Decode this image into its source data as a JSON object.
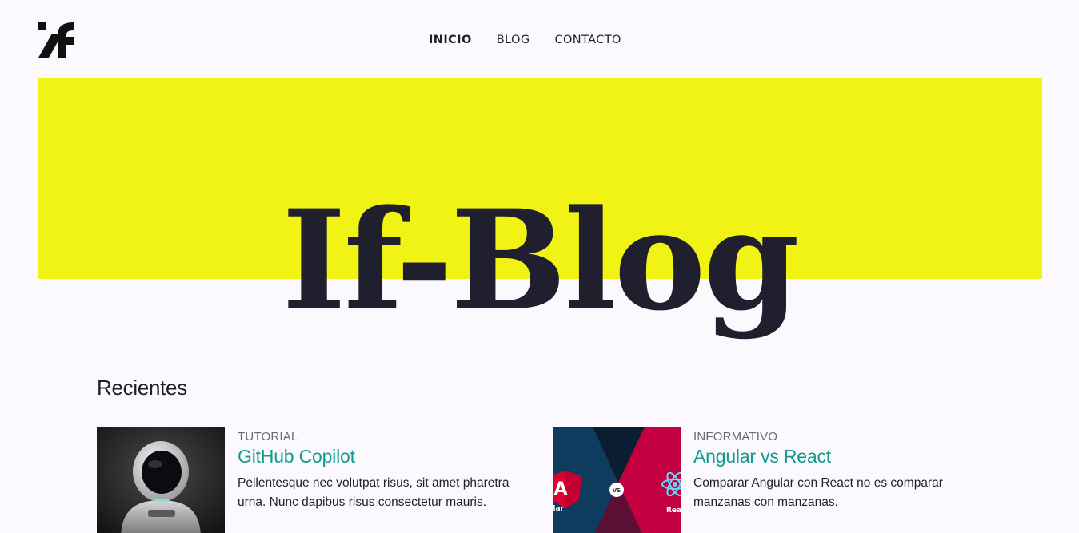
{
  "header": {
    "logo_icon": "if-logo-icon",
    "nav": [
      {
        "label": "INICIO",
        "active": true
      },
      {
        "label": "BLOG",
        "active": false
      },
      {
        "label": "CONTACTO",
        "active": false
      }
    ]
  },
  "hero": {
    "title": "If-Blog",
    "accent_color": "#f0f313"
  },
  "recent": {
    "title": "Recientes",
    "posts": [
      {
        "image": "robot-astronaut-image",
        "category": "TUTORIAL",
        "title": "GitHub Copilot",
        "excerpt": "Pellentesque nec volutpat risus, sit amet pharetra urna. Nunc dapibus risus consectetur mauris."
      },
      {
        "image": "angular-vs-react-image",
        "category": "INFORMATIVO",
        "title": "Angular vs React",
        "excerpt": "Comparar Angular con React no es comparar manzanas con manzanas.",
        "image_text": {
          "left": "ular",
          "middle": "VS",
          "right": "Reac"
        }
      }
    ]
  },
  "colors": {
    "background": "#fbf9fe",
    "text": "#201f2d",
    "link": "#0f9b8e",
    "muted": "#6b6a72"
  }
}
